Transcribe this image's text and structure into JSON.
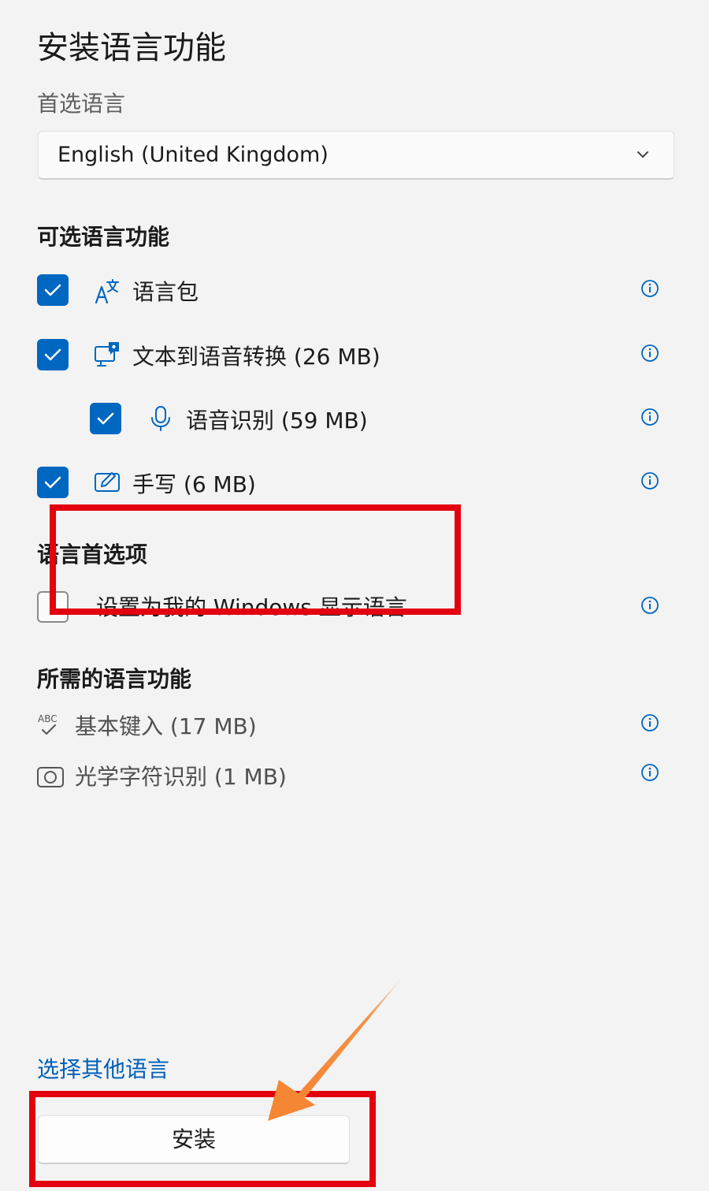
{
  "dialog": {
    "title": "安装语言功能",
    "preferred_language_label": "首选语言",
    "preferred_language_value": "English (United Kingdom)"
  },
  "optional_features": {
    "heading": "可选语言功能",
    "items": [
      {
        "label": "语言包",
        "checked": true,
        "icon": "language-pack-icon"
      },
      {
        "label": "文本到语音转换 (26 MB)",
        "checked": true,
        "icon": "text-to-speech-icon"
      },
      {
        "label": "语音识别 (59 MB)",
        "checked": true,
        "icon": "microphone-icon"
      },
      {
        "label": "手写 (6 MB)",
        "checked": true,
        "icon": "handwriting-icon"
      }
    ]
  },
  "language_preferences": {
    "heading": "语言首选项",
    "display_language_option": "设置为我的 Windows 显示语言",
    "display_language_checked": false
  },
  "required_features": {
    "heading": "所需的语言功能",
    "items": [
      {
        "label": "基本键入 (17 MB)",
        "icon": "basic-typing-icon"
      },
      {
        "label": "光学字符识别 (1 MB)",
        "icon": "ocr-icon"
      }
    ]
  },
  "footer": {
    "choose_other_link": "选择其他语言",
    "install_button": "安装"
  },
  "colors": {
    "accent": "#0067c0",
    "link": "#005fb8",
    "annotation_red": "#e3000f",
    "annotation_arrow": "#f58634"
  }
}
